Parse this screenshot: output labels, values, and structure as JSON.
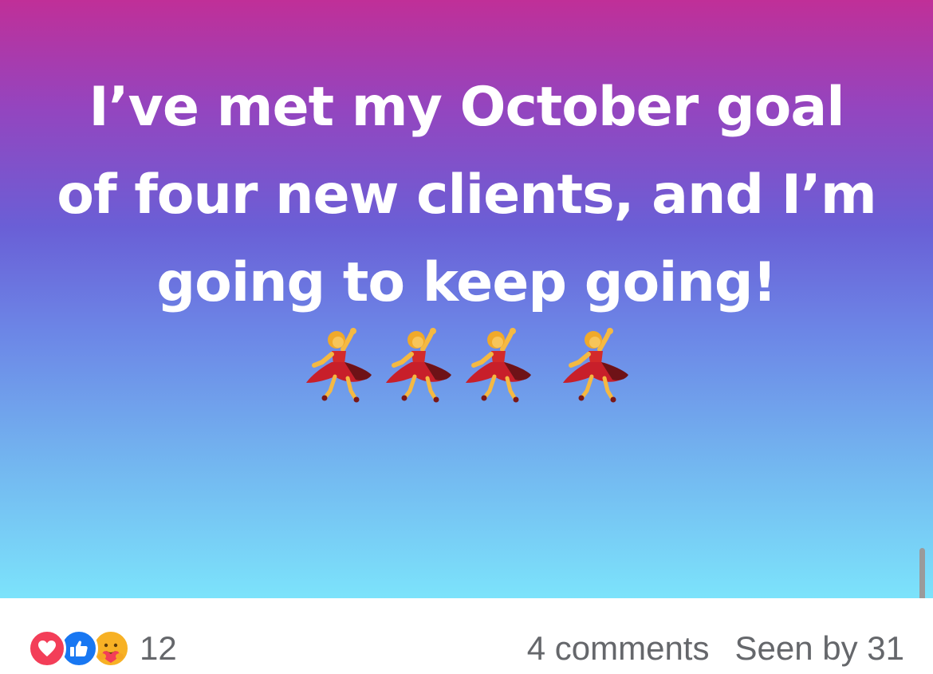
{
  "post": {
    "text_line1": "I’ve met my October goal of four new clients, and I’m going to keep going!",
    "emoji_icon": "woman-dancing-icon",
    "emoji_count": 4,
    "background_colors": [
      "#c02f98",
      "#6a5fd6",
      "#7ce3fb"
    ]
  },
  "footer": {
    "reactions": [
      "love-icon",
      "like-icon",
      "care-icon"
    ],
    "reaction_count": "12",
    "comments_label": "4 comments",
    "seen_by_label": "Seen by 31"
  },
  "colors": {
    "love": "#f33e58",
    "like": "#1877f2",
    "care": "#f7b125",
    "meta_text": "#65676b"
  }
}
